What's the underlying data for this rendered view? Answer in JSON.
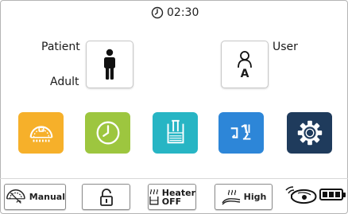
{
  "status": {
    "time": "02:30",
    "clock_icon": "clock-icon"
  },
  "patient": {
    "label": "Patient",
    "type_label": "Adult",
    "icon": "adult-person-icon"
  },
  "user": {
    "label": "User",
    "badge": "A",
    "icon": "user-profile-icon"
  },
  "tiles": [
    {
      "name": "therapy-dial-tile",
      "icon": "dial-gauge-icon",
      "color": "#f6b02a"
    },
    {
      "name": "timer-tile",
      "icon": "clock-icon",
      "color": "#9dc63f"
    },
    {
      "name": "humidifier-tile",
      "icon": "water-chamber-icon",
      "color": "#27b5c4"
    },
    {
      "name": "connection-tile",
      "icon": "plug-connector-icon",
      "color": "#2d86d8"
    },
    {
      "name": "settings-tile",
      "icon": "gear-icon",
      "color": "#1f3b5c"
    }
  ],
  "toolbar": {
    "manual": {
      "label": "Manual",
      "icon": "manual-mode-icon"
    },
    "lock": {
      "icon": "unlocked-padlock-icon"
    },
    "heater": {
      "label": "Heater",
      "state": "OFF",
      "icon": "heater-icon"
    },
    "humidity": {
      "label": "High",
      "icon": "humidity-icon"
    },
    "sensor": {
      "icon": "wireless-sensor-icon"
    },
    "battery": {
      "icon": "battery-icon",
      "level": 1.0
    }
  }
}
